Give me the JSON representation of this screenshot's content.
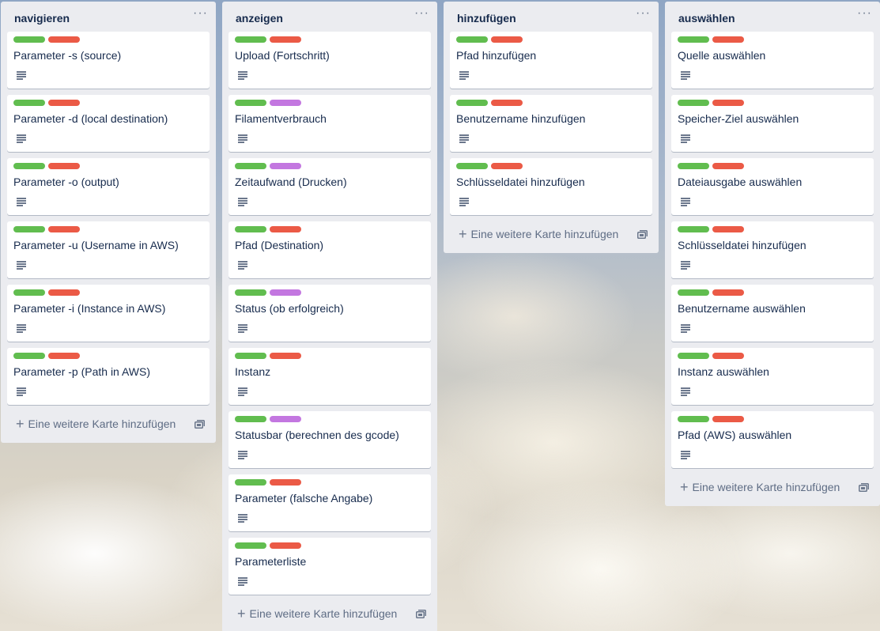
{
  "colors": {
    "label_green": "#61bd4f",
    "label_red": "#eb5a46",
    "label_purple": "#c377e0"
  },
  "add_card_label": "Eine weitere Karte hinzufügen",
  "lists": [
    {
      "title": "navigieren",
      "cards": [
        {
          "title": "Parameter -s (source)",
          "labels": [
            "green",
            "red"
          ]
        },
        {
          "title": "Parameter -d (local destination)",
          "labels": [
            "green",
            "red"
          ]
        },
        {
          "title": "Parameter -o (output)",
          "labels": [
            "green",
            "red"
          ]
        },
        {
          "title": "Parameter -u (Username in AWS)",
          "labels": [
            "green",
            "red"
          ]
        },
        {
          "title": "Parameter -i (Instance in AWS)",
          "labels": [
            "green",
            "red"
          ]
        },
        {
          "title": "Parameter -p (Path in AWS)",
          "labels": [
            "green",
            "red"
          ]
        }
      ]
    },
    {
      "title": "anzeigen",
      "cards": [
        {
          "title": "Upload (Fortschritt)",
          "labels": [
            "green",
            "red"
          ]
        },
        {
          "title": "Filamentverbrauch",
          "labels": [
            "green",
            "purple"
          ]
        },
        {
          "title": "Zeitaufwand (Drucken)",
          "labels": [
            "green",
            "purple"
          ]
        },
        {
          "title": "Pfad (Destination)",
          "labels": [
            "green",
            "red"
          ]
        },
        {
          "title": "Status (ob erfolgreich)",
          "labels": [
            "green",
            "purple"
          ]
        },
        {
          "title": "Instanz",
          "labels": [
            "green",
            "red"
          ]
        },
        {
          "title": "Statusbar (berechnen des gcode)",
          "labels": [
            "green",
            "purple"
          ]
        },
        {
          "title": "Parameter (falsche Angabe)",
          "labels": [
            "green",
            "red"
          ]
        },
        {
          "title": "Parameterliste",
          "labels": [
            "green",
            "red"
          ]
        }
      ]
    },
    {
      "title": "hinzufügen",
      "cards": [
        {
          "title": "Pfad hinzufügen",
          "labels": [
            "green",
            "red"
          ]
        },
        {
          "title": "Benutzername hinzufügen",
          "labels": [
            "green",
            "red"
          ]
        },
        {
          "title": "Schlüsseldatei hinzufügen",
          "labels": [
            "green",
            "red"
          ]
        }
      ]
    },
    {
      "title": "auswählen",
      "cards": [
        {
          "title": "Quelle auswählen",
          "labels": [
            "green",
            "red"
          ]
        },
        {
          "title": "Speicher-Ziel auswählen",
          "labels": [
            "green",
            "red"
          ]
        },
        {
          "title": "Dateiausgabe auswählen",
          "labels": [
            "green",
            "red"
          ]
        },
        {
          "title": "Schlüsseldatei hinzufügen",
          "labels": [
            "green",
            "red"
          ]
        },
        {
          "title": "Benutzername auswählen",
          "labels": [
            "green",
            "red"
          ]
        },
        {
          "title": "Instanz auswählen",
          "labels": [
            "green",
            "red"
          ]
        },
        {
          "title": "Pfad (AWS) auswählen",
          "labels": [
            "green",
            "red"
          ]
        }
      ]
    }
  ]
}
